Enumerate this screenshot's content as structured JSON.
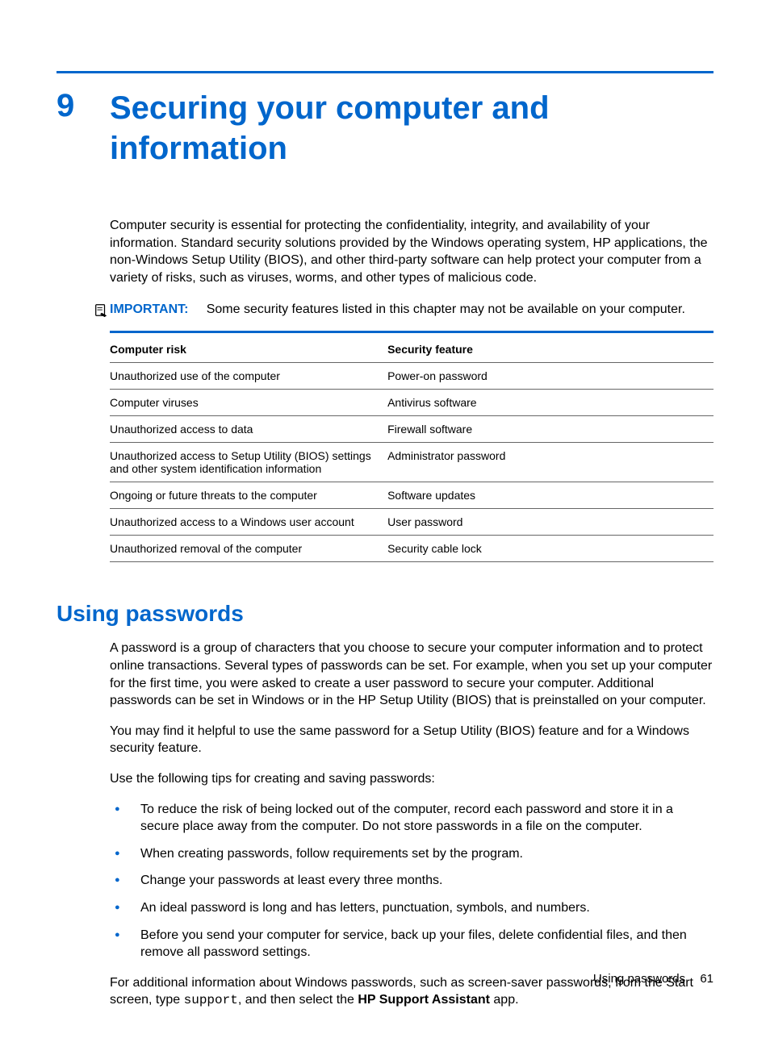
{
  "chapter": {
    "number": "9",
    "title": "Securing your computer and information"
  },
  "intro": "Computer security is essential for protecting the confidentiality, integrity, and availability of your information. Standard security solutions provided by the Windows operating system, HP applications, the non-Windows Setup Utility (BIOS), and other third-party software can help protect your computer from a variety of risks, such as viruses, worms, and other types of malicious code.",
  "important": {
    "label": "IMPORTANT:",
    "text": "Some security features listed in this chapter may not be available on your computer."
  },
  "table": {
    "headers": [
      "Computer risk",
      "Security feature"
    ],
    "rows": [
      [
        "Unauthorized use of the computer",
        "Power-on password"
      ],
      [
        "Computer viruses",
        "Antivirus software"
      ],
      [
        "Unauthorized access to data",
        "Firewall software"
      ],
      [
        "Unauthorized access to Setup Utility (BIOS) settings and other system identification information",
        "Administrator password"
      ],
      [
        "Ongoing or future threats to the computer",
        "Software updates"
      ],
      [
        "Unauthorized access to a Windows user account",
        "User password"
      ],
      [
        "Unauthorized removal of the computer",
        "Security cable lock"
      ]
    ]
  },
  "section": {
    "heading": "Using passwords",
    "p1": "A password is a group of characters that you choose to secure your computer information and to protect online transactions. Several types of passwords can be set. For example, when you set up your computer for the first time, you were asked to create a user password to secure your computer. Additional passwords can be set in Windows or in the HP Setup Utility (BIOS) that is preinstalled on your computer.",
    "p2": "You may find it helpful to use the same password for a Setup Utility (BIOS) feature and for a Windows security feature.",
    "p3": "Use the following tips for creating and saving passwords:",
    "bullets": [
      "To reduce the risk of being locked out of the computer, record each password and store it in a secure place away from the computer. Do not store passwords in a file on the computer.",
      "When creating passwords, follow requirements set by the program.",
      "Change your passwords at least every three months.",
      "An ideal password is long and has letters, punctuation, symbols, and numbers.",
      "Before you send your computer for service, back up your files, delete confidential files, and then remove all password settings."
    ],
    "p4_pre": "For additional information about Windows passwords, such as screen-saver passwords, from the Start screen, type ",
    "p4_code": "support",
    "p4_mid": ", and then select the ",
    "p4_bold": "HP Support Assistant",
    "p4_end": " app."
  },
  "footer": {
    "text": "Using passwords",
    "page": "61"
  }
}
